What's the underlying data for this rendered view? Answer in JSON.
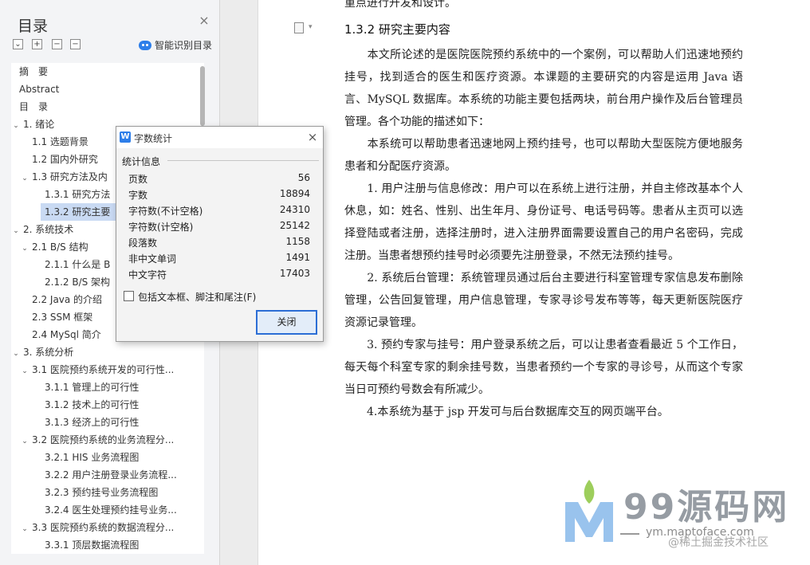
{
  "toc": {
    "title": "目录",
    "close_icon": "×",
    "expand_icon": "⌄",
    "expand_all_icon": "+",
    "collapse_all_icon": "−",
    "smart_toc_label": "智能识别目录",
    "items": [
      {
        "label": "摘　要",
        "level": 0,
        "arrow": ""
      },
      {
        "label": "Abstract",
        "level": 0,
        "arrow": ""
      },
      {
        "label": "目　录",
        "level": 0,
        "arrow": ""
      },
      {
        "label": "1.  绪论",
        "level": 0,
        "arrow": "⌄"
      },
      {
        "label": "1.1  选题背景",
        "level": 1,
        "arrow": ""
      },
      {
        "label": "1.2  国内外研究",
        "level": 1,
        "arrow": ""
      },
      {
        "label": "1.3  研究方法及内",
        "level": 1,
        "arrow": "⌄"
      },
      {
        "label": "1.3.1  研究方法",
        "level": 2,
        "arrow": ""
      },
      {
        "label": "1.3.2  研究主要",
        "level": 2,
        "arrow": "",
        "selected": true
      },
      {
        "label": "2.  系统技术",
        "level": 0,
        "arrow": "⌄"
      },
      {
        "label": "2.1  B/S 结构",
        "level": 1,
        "arrow": "⌄"
      },
      {
        "label": "2.1.1  什么是 B",
        "level": 2,
        "arrow": ""
      },
      {
        "label": "2.1.2  B/S 架构",
        "level": 2,
        "arrow": ""
      },
      {
        "label": "2.2  Java 的介绍",
        "level": 1,
        "arrow": ""
      },
      {
        "label": "2.3  SSM 框架",
        "level": 1,
        "arrow": ""
      },
      {
        "label": "2.4  MySql 简介",
        "level": 1,
        "arrow": ""
      },
      {
        "label": "3.  系统分析",
        "level": 0,
        "arrow": "⌄"
      },
      {
        "label": "3.1  医院预约系统开发的可行性...",
        "level": 1,
        "arrow": "⌄"
      },
      {
        "label": "3.1.1  管理上的可行性",
        "level": 2,
        "arrow": ""
      },
      {
        "label": "3.1.2  技术上的可行性",
        "level": 2,
        "arrow": ""
      },
      {
        "label": "3.1.3  经济上的可行性",
        "level": 2,
        "arrow": ""
      },
      {
        "label": "3.2  医院预约系统的业务流程分...",
        "level": 1,
        "arrow": "⌄"
      },
      {
        "label": "3.2.1  HIS 业务流程图",
        "level": 2,
        "arrow": ""
      },
      {
        "label": "3.2.2  用户注册登录业务流程...",
        "level": 2,
        "arrow": ""
      },
      {
        "label": "3.2.3  预约挂号业务流程图",
        "level": 2,
        "arrow": ""
      },
      {
        "label": "3.2.4  医生处理预约挂号业务...",
        "level": 2,
        "arrow": ""
      },
      {
        "label": "3.3  医院预约系统的数据流程分...",
        "level": 1,
        "arrow": "⌄"
      },
      {
        "label": "3.3.1  顶层数据流程图",
        "level": 2,
        "arrow": ""
      }
    ]
  },
  "dialog": {
    "title": "字数统计",
    "app_icon": "W",
    "close_icon": "×",
    "section_title": "统计信息",
    "stats": [
      {
        "label": "页数",
        "value": "56"
      },
      {
        "label": "字数",
        "value": "18894"
      },
      {
        "label": "字符数(不计空格)",
        "value": "24310"
      },
      {
        "label": "字符数(计空格)",
        "value": "25142"
      },
      {
        "label": "段落数",
        "value": "1158"
      },
      {
        "label": "非中文单词",
        "value": "1491"
      },
      {
        "label": "中文字符",
        "value": "17403"
      }
    ],
    "checkbox_label": "包括文本框、脚注和尾注(F)",
    "checkbox_checked": false,
    "close_button_label": "关闭"
  },
  "document": {
    "top_partial": "重点进行开发和设计。",
    "heading": "1.3.2 研究主要内容",
    "icon_caret": "▾",
    "paragraphs": [
      {
        "text": "　　本文所论述的是医院医院预约系统中的一个案例，可以帮助人们迅速地预约挂号，找到适合的医生和医疗资源。本课题的主要研究的内容是运用 Java 语言、MySQL 数据库。本系统的功能主要包括两块，前台用户操作及后台管理员管理。各个功能的描述如下："
      },
      {
        "text": "　　本系统可以帮助患者迅速地网上预约挂号，也可以帮助大型医院方便地服务患者和分配医疗资源。"
      },
      {
        "text": "　　1. 用户注册与信息修改：用户可以在系统上进行注册，并自主修改基本个人休息，如：姓名、性别、出生年月、身份证号、电话号码等。患者从主页可以选择登陆或者注册，选择注册时，进入注册界面需要设置自己的用户名密码，完成注册。当患者想预约挂号时必须要先注册登录，不然无法预约挂号。"
      },
      {
        "text": "　　2. 系统后台管理：系统管理员通过后台主要进行科室管理专家信息发布删除管理，公告回复管理，用户信息管理，专家寻诊号发布等等，每天更新医院医疗资源记录管理。"
      },
      {
        "text": "　　3. 预约专家与挂号：用户登录系统之后，可以让患者查看最近 5 个工作日，每天每个科室专家的剩余挂号数，当患者预约一个专家的寻诊号，从而这个专家当日可预约号数会有所减少。"
      },
      {
        "text": "　　4.本系统为基于 jsp 开发可与后台数据库交互的网页端平台。"
      }
    ]
  },
  "watermark": {
    "brand": "99源码网",
    "url": "ym.maptoface.com",
    "community": "@稀土掘金技术社区",
    "colors": {
      "leaf_green": "#8cc63f",
      "m_blue": "#7fb4e8"
    }
  }
}
